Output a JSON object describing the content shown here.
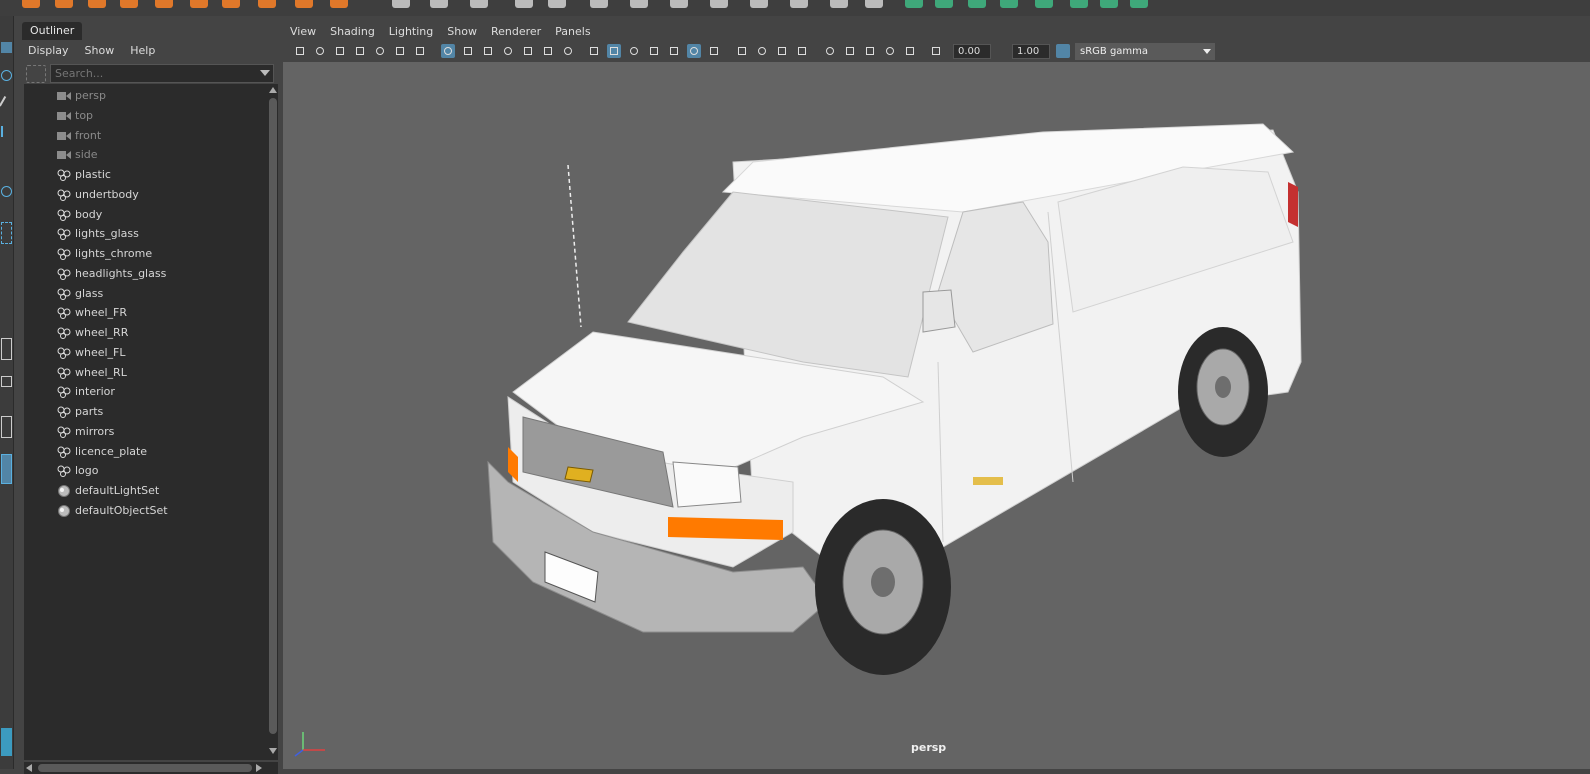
{
  "colors": {
    "accent": "#5285a6",
    "panel_bg": "#444444",
    "tree_bg": "#2b2b2b",
    "viewport_bg": "#646464",
    "orange_indicator": "#ff7a00",
    "shelf_icon": "#e0782a",
    "shelf_green": "#3fa87a"
  },
  "outliner": {
    "tab_label": "Outliner",
    "menu": [
      "Display",
      "Show",
      "Help"
    ],
    "search_placeholder": "Search...",
    "items": [
      {
        "label": "persp",
        "icon": "camera-icon",
        "dim": true
      },
      {
        "label": "top",
        "icon": "camera-icon",
        "dim": true
      },
      {
        "label": "front",
        "icon": "camera-icon",
        "dim": true
      },
      {
        "label": "side",
        "icon": "camera-icon",
        "dim": true
      },
      {
        "label": "plastic",
        "icon": "group-icon",
        "dim": false
      },
      {
        "label": "undertbody",
        "icon": "group-icon",
        "dim": false
      },
      {
        "label": "body",
        "icon": "group-icon",
        "dim": false
      },
      {
        "label": "lights_glass",
        "icon": "group-icon",
        "dim": false
      },
      {
        "label": "lights_chrome",
        "icon": "group-icon",
        "dim": false
      },
      {
        "label": "headlights_glass",
        "icon": "group-icon",
        "dim": false
      },
      {
        "label": "glass",
        "icon": "group-icon",
        "dim": false
      },
      {
        "label": "wheel_FR",
        "icon": "group-icon",
        "dim": false
      },
      {
        "label": "wheel_RR",
        "icon": "group-icon",
        "dim": false
      },
      {
        "label": "wheel_FL",
        "icon": "group-icon",
        "dim": false
      },
      {
        "label": "wheel_RL",
        "icon": "group-icon",
        "dim": false
      },
      {
        "label": "interior",
        "icon": "group-icon",
        "dim": false
      },
      {
        "label": "parts",
        "icon": "group-icon",
        "dim": false
      },
      {
        "label": "mirrors",
        "icon": "group-icon",
        "dim": false
      },
      {
        "label": "licence_plate",
        "icon": "group-icon",
        "dim": false
      },
      {
        "label": "logo",
        "icon": "group-icon",
        "dim": false
      },
      {
        "label": "defaultLightSet",
        "icon": "set-icon",
        "dim": false
      },
      {
        "label": "defaultObjectSet",
        "icon": "set-icon",
        "dim": false
      }
    ]
  },
  "viewport": {
    "menu": [
      "View",
      "Shading",
      "Lighting",
      "Show",
      "Renderer",
      "Panels"
    ],
    "exposure_value": "0.00",
    "gamma_value": "1.00",
    "color_space": "sRGB gamma",
    "camera_label": "persp"
  }
}
